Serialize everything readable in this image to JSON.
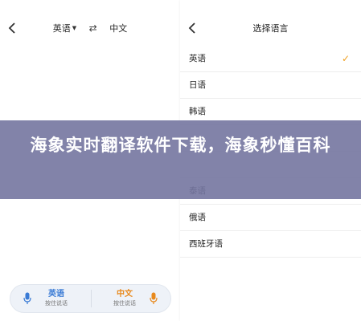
{
  "left_screen": {
    "nav": {
      "back_icon": "chevron-left-icon",
      "source_lang": "英语",
      "swap_icon": "swap-arrows-icon",
      "target_lang": "中文"
    },
    "voice_buttons": [
      {
        "lang": "英语",
        "hint": "按住说话",
        "icon": "microphone-icon",
        "color": "#3a7bd5"
      },
      {
        "lang": "中文",
        "hint": "按住说话",
        "icon": "microphone-icon",
        "color": "#e8891c"
      }
    ]
  },
  "right_screen": {
    "nav": {
      "back_icon": "chevron-left-icon",
      "title": "选择语言"
    },
    "languages": [
      {
        "label": "英语",
        "selected": true
      },
      {
        "label": "日语",
        "selected": false
      },
      {
        "label": "韩语",
        "selected": false
      },
      {
        "label": "",
        "selected": false
      },
      {
        "label": "",
        "selected": false
      },
      {
        "label": "泰语",
        "selected": false
      },
      {
        "label": "俄语",
        "selected": false
      },
      {
        "label": "西班牙语",
        "selected": false
      }
    ],
    "check_color": "#f0a020"
  },
  "overlay": {
    "title": "海象实时翻译软件下载，海象秒懂百科",
    "background": "#7476a0"
  }
}
